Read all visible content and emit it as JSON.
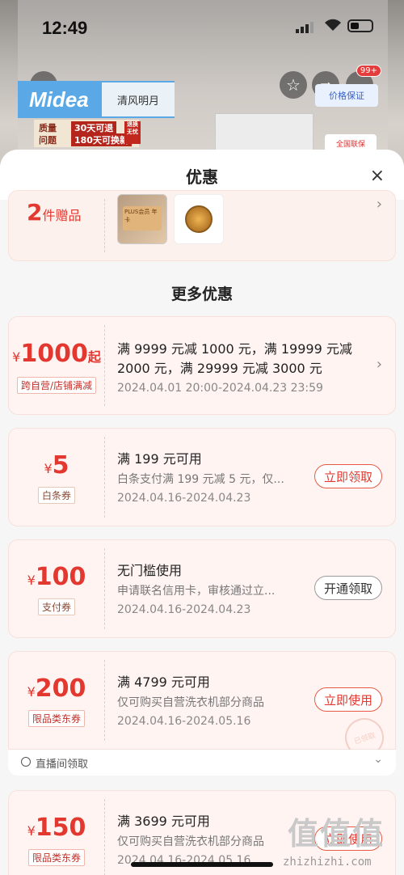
{
  "status_bar": {
    "time": "12:49"
  },
  "background": {
    "brand_logo": "Midea",
    "brand_chip": "清风明月",
    "promo": {
      "line1": "质量",
      "line2": "问题",
      "tag1": "30天可退",
      "tag2": "180天可换新",
      "badge": "退换无忧"
    },
    "safeguard": "价格保证",
    "shipping": "全国联保",
    "badge_count": "99+"
  },
  "sheet": {
    "title": "优惠",
    "gift": {
      "count": "2",
      "label": "件赠品",
      "img1_text": "PLUS会员 年卡"
    },
    "section_title": "更多优惠",
    "coupons": [
      {
        "yen": "¥",
        "amount": "1000",
        "suffix": "起",
        "tag": "跨自营/店铺满减",
        "line1": "满 9999 元减 1000 元，满 19999 元减",
        "line2": "2000 元，满 29999 元减 3000 元",
        "date": "2024.04.01 20:00-2024.04.23 23:59"
      },
      {
        "yen": "¥",
        "amount": "5",
        "tag": "白条券",
        "title": "满 199 元可用",
        "desc": "白条支付满 199 元减 5 元，仅...",
        "date": "2024.04.16-2024.04.23",
        "button": "立即领取"
      },
      {
        "yen": "¥",
        "amount": "100",
        "tag": "支付券",
        "title": "无门槛使用",
        "desc": "申请联名信用卡，审核通过立...",
        "date": "2024.04.16-2024.04.23",
        "button": "开通领取"
      },
      {
        "yen": "¥",
        "amount": "200",
        "tag": "限品类东券",
        "title": "满 4799 元可用",
        "desc": "仅可购买自营洗衣机部分商品",
        "date": "2024.04.16-2024.05.16",
        "button": "立即使用",
        "stamp": "已领取",
        "live": "直播间领取"
      },
      {
        "yen": "¥",
        "amount": "150",
        "tag": "限品类东券",
        "title": "满 3699 元可用",
        "desc": "仅可购买自营洗衣机部分商品",
        "date": "2024.04.16-2024.05.16",
        "button": "立即使用"
      }
    ]
  },
  "watermark": {
    "logo": "值值值",
    "url": "zhizhizhi.com"
  }
}
